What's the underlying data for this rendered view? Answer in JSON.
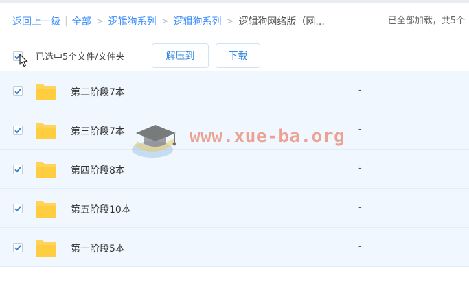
{
  "breadcrumb": {
    "back": "返回上一级",
    "items": [
      "全部",
      "逻辑狗系列",
      "逻辑狗系列"
    ],
    "current": "逻辑狗网络版（网..."
  },
  "status": "已全部加载，共5个",
  "toolbar": {
    "selection_text": "已选中5个文件/文件夹",
    "extract_label": "解压到",
    "download_label": "下载"
  },
  "files": [
    {
      "name": "第二阶段7本",
      "size": "-",
      "checked": true
    },
    {
      "name": "第三阶段7本",
      "size": "-",
      "checked": true
    },
    {
      "name": "第四阶段8本",
      "size": "-",
      "checked": true
    },
    {
      "name": "第五阶段10本",
      "size": "-",
      "checked": true
    },
    {
      "name": "第一阶段5本",
      "size": "-",
      "checked": true
    }
  ],
  "watermark": "www.xue-ba.org",
  "colors": {
    "accent": "#2e86e0",
    "row_bg": "#f0f7fe",
    "folder": "#ffd35c",
    "check": "#2e86e0"
  }
}
